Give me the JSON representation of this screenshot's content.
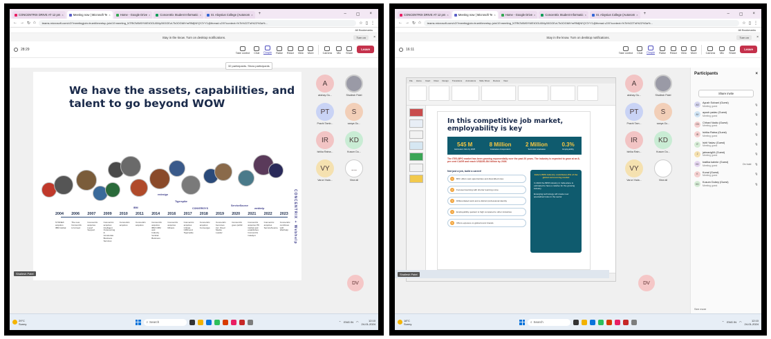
{
  "left": {
    "browser": {
      "tabs": [
        {
          "label": "CONCENTRIX DRIVE AT 12 pm",
          "color": "#e91e63",
          "active": false
        },
        {
          "label": "Meeting now | Microsoft Te",
          "color": "#5b5fc7",
          "active": true
        },
        {
          "label": "Home - Google Drive",
          "color": "#34a853",
          "active": false
        },
        {
          "label": "Concentrix Student Informatic",
          "color": "#0f9d58",
          "active": false
        },
        {
          "label": "St. Aloysius College (Autonom",
          "color": "#3367d6",
          "active": false
        }
      ],
      "url": "teams.microsoft.com/v2/?meetingjoin=true#l/meetup-join/19:meeting_NTRlOWM5YWEtOGU0My00OGEzLTk0OGMtYmRlMjNlYjY2YY1@thread.v2/0?context=%7b%22Tid%22%3a%...",
      "bookmarks": "All Bookmarks",
      "notice": "Stay in the know. Turn on desktop notifications.",
      "notice_button": "Turn on"
    },
    "meeting": {
      "timer": "28:29",
      "tools": [
        "Take control",
        "Chat",
        "People",
        "Raise",
        "React",
        "View",
        "More",
        "Camera",
        "Mic",
        "Share"
      ],
      "leave": "Leave",
      "tooltip": "32 participants. Show participants"
    },
    "slide": {
      "headline": "We have the assets, capabilities, and talent to go beyond WOW",
      "years": [
        "2004",
        "2006",
        "2007",
        "2009",
        "2010",
        "2011",
        "2014",
        "2016",
        "2017",
        "2018",
        "2019",
        "2020",
        "2021",
        "2022",
        "2023"
      ],
      "descriptions": [
        "SYNNEX acquires IBM Global",
        "The new Concentrix is formed",
        "Concentrix acquires LiveZ Support",
        "Concentrix acquires Intelligent Outsourcing & Accelerate Business Services",
        "Concentrix acquires",
        "Concentrix acquires",
        "Concentrix acquires IBM CRM and Industry Vertical Business",
        "Concentrix acquires Minacs",
        "Concentrix acquires Unitate CRM and Tigerspike",
        "Concentrix acquires Convergys",
        "Concentrix becomes ind. Fixed Media Leader",
        "Concentrix goes public",
        "Concentrix acquires PK Global and establishes Concentrix Catalyst",
        "Concentrix acquires ServiceSource",
        "Concentrix combines with Webhelp"
      ],
      "brands": [
        "IBM",
        "redesign",
        "Tigerspike",
        "CONVERGYS",
        "ServiceSource",
        "webhelp"
      ],
      "vertical_brand": "CONCENTRIX + Webhelp",
      "presenter": "Shailesh Patel"
    },
    "participants": [
      {
        "initials": "A",
        "name": "akshay Gu...",
        "color": "#f2c4c4"
      },
      {
        "initials": "",
        "name": "Shailesh Patel",
        "color": "#9a9aa6"
      },
      {
        "initials": "PT",
        "name": "Prachi Tamb...",
        "color": "#c9d3f5"
      },
      {
        "initials": "S",
        "name": "sanya Gu...",
        "color": "#f2cfb8"
      },
      {
        "initials": "IR",
        "name": "Ishika Ratna...",
        "color": "#f2c4c4"
      },
      {
        "initials": "KD",
        "name": "Kusum Du...",
        "color": "#c9ecd4"
      },
      {
        "initials": "VY",
        "name": "Varun Yada...",
        "color": "#f5e1b0"
      },
      {
        "initials": "...",
        "name": "View all",
        "color": "#ffffff"
      }
    ],
    "floater": "DV",
    "taskbar": {
      "temp": "29°C",
      "weather": "Sunny",
      "search": "Search",
      "lang": "ENG IN",
      "time": "12:10",
      "date": "24-01-2024"
    }
  },
  "right": {
    "browser": {
      "tabs": [
        {
          "label": "CONCENTRIX DRIVE AT 12 pm",
          "color": "#e91e63",
          "active": false
        },
        {
          "label": "Meeting now | Microsoft Te",
          "color": "#5b5fc7",
          "active": true
        },
        {
          "label": "Home - Google Drive",
          "color": "#34a853",
          "active": false
        },
        {
          "label": "Concentrix Student Informatic",
          "color": "#0f9d58",
          "active": false
        },
        {
          "label": "St. Aloysius College (Autonom",
          "color": "#3367d6",
          "active": false
        }
      ],
      "url": "teams.microsoft.com/v2/?meetingjoin=true#l/meetup-join/19:meeting_NTRlOWM5YWEtOGU0My00OGEzLTk0OGMtYmRlMjNlYjY2YY1@thread.v2/0?context=%7b%22Tid%22%3a%...",
      "bookmarks": "All Bookmarks",
      "notice": "Stay in the know. Turn on desktop notifications.",
      "notice_button": "Turn on"
    },
    "meeting": {
      "timer": "16:11",
      "tools": [
        "Take control",
        "Chat",
        "People",
        "Raise",
        "React",
        "View",
        "More",
        "Camera",
        "Mic",
        "Share"
      ],
      "leave": "Leave"
    },
    "slide": {
      "title": "In this competitive job market, employability is key",
      "stats": [
        {
          "value": "545 M",
          "label": "Estimated Jobs by 2025"
        },
        {
          "value": "8 Million",
          "label": "Graduates & Equivalent"
        },
        {
          "value": "2 Million",
          "label": "Technical Graduates"
        },
        {
          "value": "0.3%",
          "label": "Employability"
        }
      ],
      "intro": "The ITES-BPO market has been growing exponentially over the past 20 years. The industry is expected to grow at an 8-per cent CAGR and reach US$226-284 billion by 2026.",
      "bullets_heading": "Not just a job, build a career!",
      "bullets": [
        "Bi'hr offers vast opportunities and diversified roles",
        "Focused learning with shorter learning curve",
        "Differentiated work and a distinct professional identity",
        "Employability quotient is high compared to other industries",
        "Offers exposure to global iconic brands"
      ],
      "teal_heading": "India's BPO industry contributes 8% of the global outsourcing market",
      "teal_points": [
        "In 2022 the BPM industry in India alone is estimated to have a relative for the growing industry",
        "Emerging technology will create new specialized roles in the sector"
      ],
      "presenter": "Shailesh Patel"
    },
    "participants": [
      {
        "initials": "A",
        "name": "akshay Gu...",
        "color": "#f2c4c4"
      },
      {
        "initials": "",
        "name": "Shailesh Patel",
        "color": "#9a9aa6"
      },
      {
        "initials": "PT",
        "name": "Prachi Tam...",
        "color": "#c9d3f5"
      },
      {
        "initials": "S",
        "name": "sanya Gu...",
        "color": "#f2cfb8"
      },
      {
        "initials": "IR",
        "name": "Ishika Ratn...",
        "color": "#f2c4c4"
      },
      {
        "initials": "KD",
        "name": "Kusum Du...",
        "color": "#c9ecd4"
      },
      {
        "initials": "VY",
        "name": "Varun Yada...",
        "color": "#f5e1b0"
      },
      {
        "initials": "",
        "name": "View all",
        "color": "#ffffff"
      }
    ],
    "floater": "DV",
    "panel": {
      "title": "Participants",
      "share": "Share invite",
      "people": [
        {
          "initials": "AS",
          "name": "Ayush Solvani (Guest)",
          "role": "Meeting guest",
          "color": "#d6d6f0",
          "extra": ""
        },
        {
          "initials": "AY",
          "name": "ayush yadav (Guest)",
          "role": "Meeting guest",
          "color": "#d0e4f5",
          "extra": ""
        },
        {
          "initials": "CN",
          "name": "Chhavi Naidu (Guest)",
          "role": "Meeting guest",
          "color": "#f5d0d0",
          "extra": ""
        },
        {
          "initials": "IR",
          "name": "Ishika Ratna (Guest)",
          "role": "Meeting guest",
          "color": "#f5d0d0",
          "extra": ""
        },
        {
          "initials": "IY",
          "name": "Ishit Yadav (Guest)",
          "role": "Meeting guest",
          "color": "#d6ecd6",
          "extra": ""
        },
        {
          "initials": "J",
          "name": "jahnavig54 (Guest)",
          "role": "Meeting guest",
          "color": "#f5e1b0",
          "extra": ""
        },
        {
          "initials": "KK",
          "name": "kratika kalmkr (Guest)",
          "role": "Meeting guest",
          "color": "#e5d6f0",
          "extra": "On hold"
        },
        {
          "initials": "K",
          "name": "Kunal (Guest)",
          "role": "Meeting guest",
          "color": "#f5d0d0",
          "extra": ""
        },
        {
          "initials": "KD",
          "name": "Kusum Dubey (Guest)",
          "role": "Meeting guest",
          "color": "#d6ecd6",
          "extra": ""
        }
      ],
      "see_more": "See more"
    },
    "taskbar": {
      "temp": "18°C",
      "weather": "Sunny",
      "search": "Search",
      "lang": "ENG IN",
      "time": "12:10",
      "date": "24-01-2024"
    }
  }
}
